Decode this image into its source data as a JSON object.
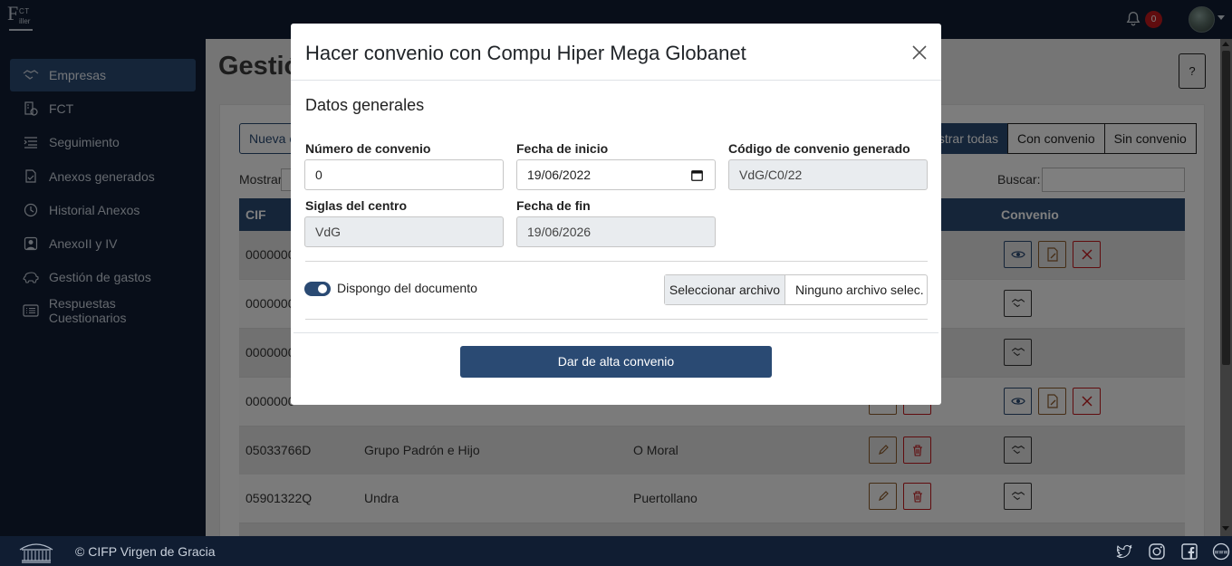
{
  "app": {
    "logo_text_top": "CT",
    "logo_text_bottom": "iller",
    "logo_letter": "F"
  },
  "header": {
    "notification_count": "0"
  },
  "sidebar": {
    "items": [
      {
        "label": "Empresas",
        "icon": "handshake-icon",
        "active": true
      },
      {
        "label": "FCT",
        "icon": "building-check-icon"
      },
      {
        "label": "Seguimiento",
        "icon": "list-indent-icon"
      },
      {
        "label": "Anexos generados",
        "icon": "file-check-icon"
      },
      {
        "label": "Historial Anexos",
        "icon": "clock-history-icon"
      },
      {
        "label": "AnexoII y IV",
        "icon": "person-badge-icon"
      },
      {
        "label": "Gestión de gastos",
        "icon": "piggy-bank-icon"
      },
      {
        "label": "Respuestas Cuestionarios",
        "icon": "card-list-icon"
      }
    ]
  },
  "main": {
    "title": "Gestió",
    "help_label": "?",
    "new_button_label": "Nueva e",
    "filters": {
      "all": "strar todas",
      "with": "Con convenio",
      "without": "Sin convenio"
    },
    "show_label": "Mostrar",
    "search_label": "Buscar:",
    "table": {
      "headers": {
        "cif": "CIF",
        "convenio": "Convenio"
      },
      "rows": [
        {
          "cif": "0000000",
          "name": "",
          "city": ""
        },
        {
          "cif": "0000000",
          "name": "",
          "city": ""
        },
        {
          "cif": "0000000",
          "name": "",
          "city": ""
        },
        {
          "cif": "0000000",
          "name": "",
          "city": ""
        },
        {
          "cif": "05033766D",
          "name": "Grupo Padrón e Hijo",
          "city": "O Moral"
        },
        {
          "cif": "05901322Q",
          "name": "Undra",
          "city": "Puertollano"
        }
      ]
    }
  },
  "footer": {
    "text": "© CIFP Virgen de Gracia"
  },
  "modal": {
    "title": "Hacer convenio con Compu Hiper Mega Globanet",
    "section": "Datos generales",
    "fields": {
      "numero_label": "Número de convenio",
      "numero_value": "0",
      "fecha_inicio_label": "Fecha de inicio",
      "fecha_inicio_value": "19/06/2022",
      "codigo_label": "Código de convenio generado",
      "codigo_value": "VdG/C0/22",
      "siglas_label": "Siglas del centro",
      "siglas_value": "VdG",
      "fecha_fin_label": "Fecha de fin",
      "fecha_fin_value": "19/06/2026"
    },
    "toggle_label": "Dispongo del documento",
    "file_button": "Seleccionar archivo",
    "file_name": "Ninguno archivo selec.",
    "submit_label": "Dar de alta convenio"
  },
  "colors": {
    "primary": "#2a4a73",
    "danger": "#c0191d",
    "navy": "#101d32"
  }
}
